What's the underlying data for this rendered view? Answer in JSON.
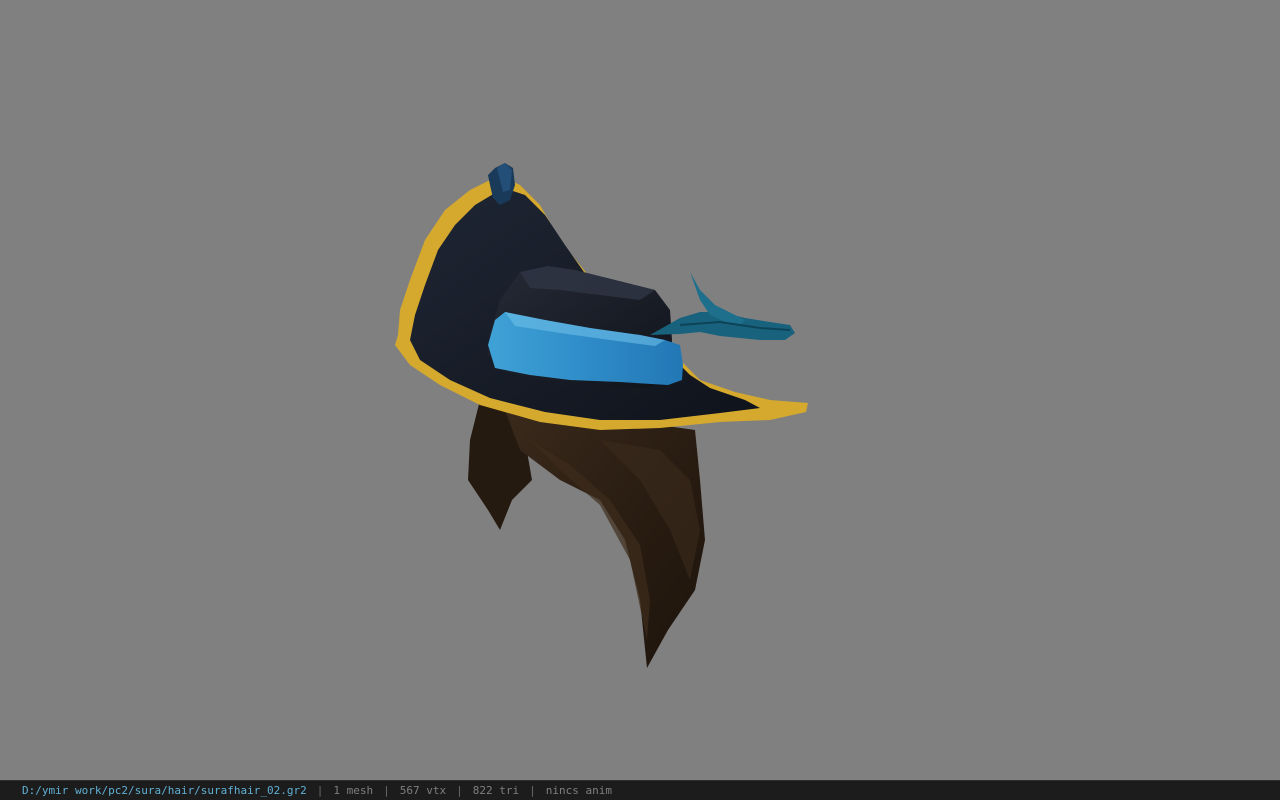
{
  "viewport": {
    "background_color": "#808080",
    "model_name": "surafhair_02"
  },
  "statusbar": {
    "file_path": "D:/ymir work/pc2/sura/hair/surafhair_02.gr2",
    "mesh_count": "1 mesh",
    "vertex_count": "567 vtx",
    "triangle_count": "822 tri",
    "anim_status": "nincs anim",
    "separator": "|",
    "path_color": "#5fb0d4"
  }
}
